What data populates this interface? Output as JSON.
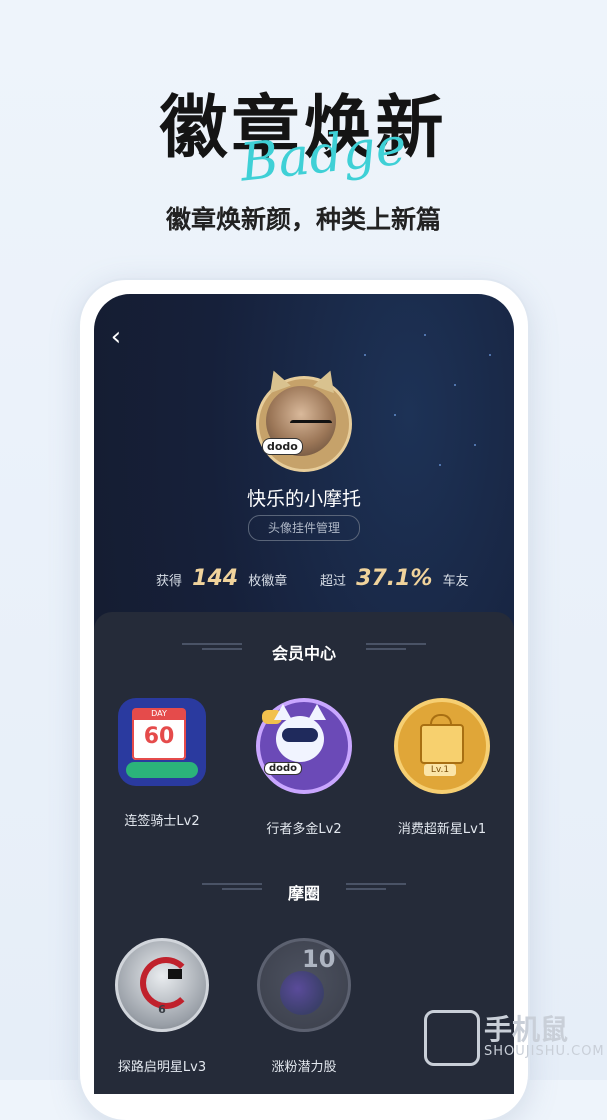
{
  "hero": {
    "title": "徽章焕新",
    "script": "Badge",
    "subtitle": "徽章焕新颜，种类上新篇"
  },
  "profile": {
    "username": "快乐的小摩托",
    "avatar_tag": "dodo",
    "manage_button": "头像挂件管理"
  },
  "stats": {
    "earned_prefix": "获得",
    "earned_count": "144",
    "earned_suffix": "枚徽章",
    "exceed_prefix": "超过",
    "exceed_percent": "37.1%",
    "exceed_suffix": "车友"
  },
  "sections": [
    {
      "title": "会员中心",
      "badges": [
        {
          "label": "连签骑士Lv2",
          "art_day": "DAY",
          "art_number": "60"
        },
        {
          "label": "行者多金Lv2",
          "art_tag": "dodo"
        },
        {
          "label": "消费超新星Lv1",
          "art_level": "Lv.1"
        }
      ]
    },
    {
      "title": "摩圈",
      "badges": [
        {
          "label": "探路启明星Lv3",
          "art_number": "6"
        },
        {
          "label": "涨粉潜力股",
          "art_number": "10"
        }
      ]
    }
  ],
  "watermark": {
    "text": "手机鼠",
    "sub": "SHOUJISHU.COM"
  },
  "colors": {
    "accent_gold": "#f0d39c",
    "script_teal": "#3fd0d6",
    "screen_bg": "#16203a",
    "panel_bg": "#252b39"
  }
}
